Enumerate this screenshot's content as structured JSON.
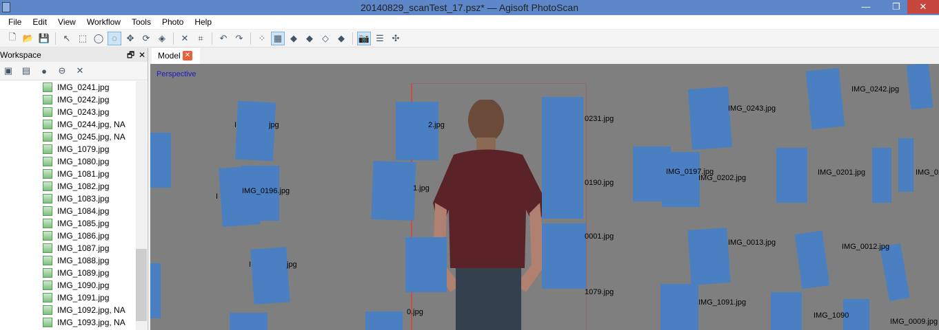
{
  "window": {
    "title": "20140829_scanTest_17.psz* — Agisoft PhotoScan",
    "minimize": "—",
    "restore": "❐",
    "close": "✕"
  },
  "menu": [
    "File",
    "Edit",
    "View",
    "Workflow",
    "Tools",
    "Photo",
    "Help"
  ],
  "toolbar": [
    {
      "icon": "new-icon",
      "g": "🗋"
    },
    {
      "icon": "open-icon",
      "g": "📂"
    },
    {
      "icon": "save-icon",
      "g": "💾"
    },
    {
      "sep": true
    },
    {
      "icon": "navigate-icon",
      "g": "↖"
    },
    {
      "icon": "rect-select-icon",
      "g": "⬚"
    },
    {
      "icon": "circle-select-icon",
      "g": "◯"
    },
    {
      "icon": "free-select-icon",
      "g": "◌",
      "on": true
    },
    {
      "icon": "move-object-icon",
      "g": "✥"
    },
    {
      "icon": "rotate-object-icon",
      "g": "⟳"
    },
    {
      "icon": "scale-object-icon",
      "g": "◈"
    },
    {
      "sep": true
    },
    {
      "icon": "delete-icon",
      "g": "✕"
    },
    {
      "icon": "crop-icon",
      "g": "⌗"
    },
    {
      "sep": true
    },
    {
      "icon": "undo-icon",
      "g": "↶"
    },
    {
      "icon": "redo-icon",
      "g": "↷"
    },
    {
      "sep": true
    },
    {
      "icon": "point-cloud-icon",
      "g": "⁘"
    },
    {
      "icon": "dense-cloud-icon",
      "g": "▦",
      "on": true
    },
    {
      "icon": "shaded-icon",
      "g": "◆"
    },
    {
      "icon": "solid-icon",
      "g": "◆"
    },
    {
      "icon": "wireframe-icon",
      "g": "◇"
    },
    {
      "icon": "textured-icon",
      "g": "◆"
    },
    {
      "sep": true
    },
    {
      "icon": "show-cameras-icon",
      "g": "📷",
      "on": true
    },
    {
      "icon": "show-regions-icon",
      "g": "☰"
    },
    {
      "icon": "reset-view-icon",
      "g": "✣"
    }
  ],
  "workspace": {
    "title": "Workspace",
    "float": "🗗",
    "close": "✕",
    "tools": [
      {
        "icon": "add-chunk-icon",
        "g": "▣"
      },
      {
        "icon": "add-photos-icon",
        "g": "▤"
      },
      {
        "icon": "enable-icon",
        "g": "●"
      },
      {
        "icon": "disable-icon",
        "g": "⊖"
      },
      {
        "icon": "remove-icon",
        "g": "✕"
      }
    ],
    "items": [
      "IMG_0241.jpg",
      "IMG_0242.jpg",
      "IMG_0243.jpg",
      "IMG_0244.jpg, NA",
      "IMG_0245.jpg, NA",
      "IMG_1079.jpg",
      "IMG_1080.jpg",
      "IMG_1081.jpg",
      "IMG_1082.jpg",
      "IMG_1083.jpg",
      "IMG_1084.jpg",
      "IMG_1085.jpg",
      "IMG_1086.jpg",
      "IMG_1087.jpg",
      "IMG_1088.jpg",
      "IMG_1089.jpg",
      "IMG_1090.jpg",
      "IMG_1091.jpg",
      "IMG_1092.jpg, NA",
      "IMG_1093.jpg, NA"
    ]
  },
  "model_tab": {
    "label": "Model",
    "close": "✕"
  },
  "viewport": {
    "projection": "Perspective",
    "labels": [
      "I",
      "jpg",
      "2.jpg",
      "0231.jpg",
      "IMG_0243.jpg",
      "IMG_0242.jpg",
      "IMG_0196.jpg",
      "I",
      "1.jpg",
      "0190.jpg",
      "IMG_0197.jpg",
      "IMG_0202.jpg",
      "IMG_0201.jpg",
      "IMG_02",
      "0001.jpg",
      "IMG_0013.jpg",
      "IMG_0012.jpg",
      "I",
      "jpg",
      "1079.jpg",
      "IMG_1091.jpg",
      "IMG_1090",
      "IMG_0009.jpg",
      "0.jpg"
    ]
  }
}
